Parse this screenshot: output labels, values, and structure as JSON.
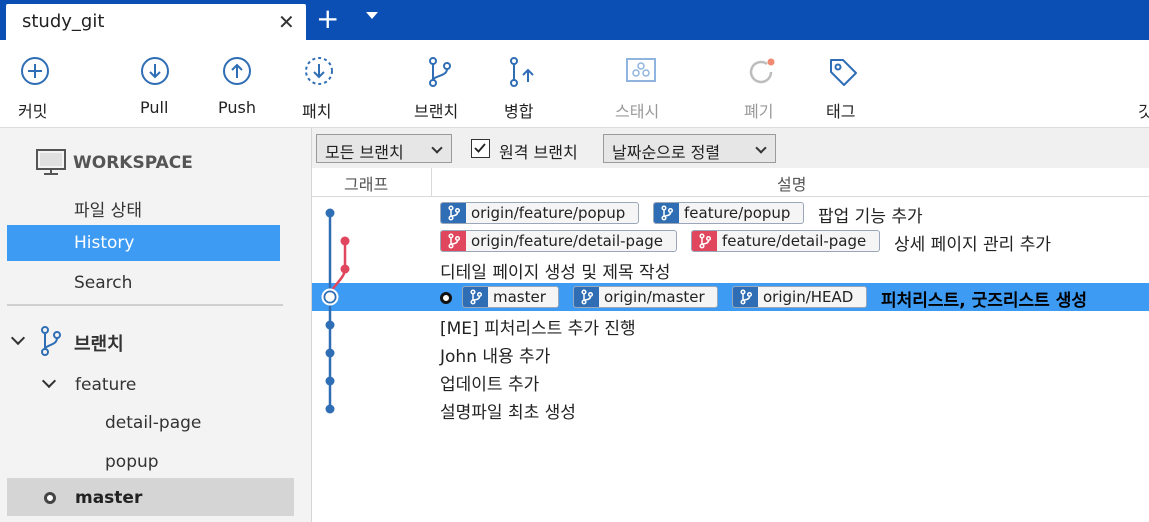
{
  "tab": {
    "title": "study_git"
  },
  "toolbar": {
    "commit": "커밋",
    "pull": "Pull",
    "push": "Push",
    "patch": "패치",
    "branch": "브랜치",
    "merge": "병합",
    "stash": "스태시",
    "discard": "폐기",
    "tag": "태그",
    "overflow": "깃"
  },
  "sidebar": {
    "workspace": "WORKSPACE",
    "items": [
      "파일 상태",
      "History",
      "Search"
    ],
    "active_item": "History",
    "branches_header": "브랜치",
    "feature_folder": "feature",
    "feature_branches": [
      "detail-page",
      "popup"
    ],
    "current_branch": "master"
  },
  "filters": {
    "branch_filter": "모든 브랜치",
    "remote_label": "원격 브랜치",
    "remote_checked": true,
    "sort": "날짜순으로 정렬"
  },
  "columns": {
    "graph": "그래프",
    "description": "설명"
  },
  "commits": [
    {
      "refs": [
        {
          "name": "origin/feature/popup",
          "color": "blue"
        },
        {
          "name": "feature/popup",
          "color": "blue"
        }
      ],
      "message": "팝업 기능 추가"
    },
    {
      "refs": [
        {
          "name": "origin/feature/detail-page",
          "color": "red"
        },
        {
          "name": "feature/detail-page",
          "color": "red"
        }
      ],
      "message": "상세 페이지 관리 추가"
    },
    {
      "refs": [],
      "message": "디테일 페이지 생성 및 제목 작성"
    },
    {
      "refs": [
        {
          "name": "master",
          "color": "blue"
        },
        {
          "name": "origin/master",
          "color": "blue"
        },
        {
          "name": "origin/HEAD",
          "color": "blue"
        }
      ],
      "message": "피처리스트, 굿즈리스트 생성",
      "head": true,
      "selected": true
    },
    {
      "refs": [],
      "message": "[ME] 피처리스트 추가 진행"
    },
    {
      "refs": [],
      "message": "John 내용 추가"
    },
    {
      "refs": [],
      "message": "업데이트 추가"
    },
    {
      "refs": [],
      "message": "설명파일 최초 생성"
    }
  ],
  "colors": {
    "accent": "#3d9bf3",
    "titlebar": "#0b4fb5",
    "branch_blue": "#2f6eb5",
    "branch_red": "#e0465e"
  }
}
